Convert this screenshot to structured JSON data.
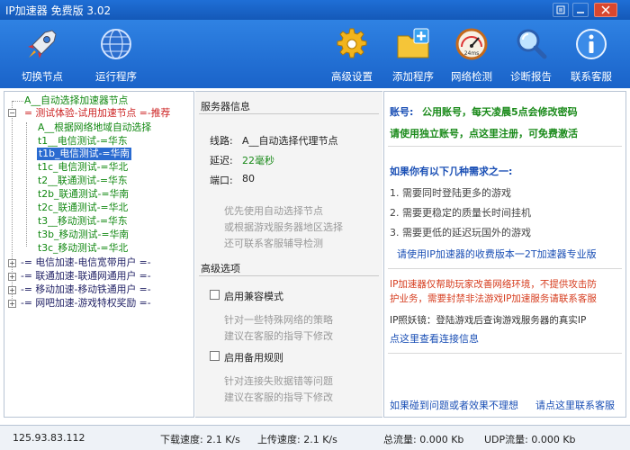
{
  "window": {
    "title": "IP加速器 免费版 3.02"
  },
  "toolbar": {
    "switch_node": "切换节点",
    "run_program": "运行程序",
    "advanced": "高级设置",
    "add_program": "添加程序",
    "net_detect": "网络检测",
    "diag_report": "诊断报告",
    "contact": "联系客服",
    "gauge_text": "24ms"
  },
  "tree": {
    "items": [
      {
        "text": "A__自动选择加速器节点"
      },
      {
        "text": "= 测试体验-试用加速节点 =-推荐"
      },
      {
        "text": "A__根据网络地域自动选择"
      },
      {
        "text": "t1__电信测试-=华东"
      },
      {
        "text": "t1b_电信测试-=华南"
      },
      {
        "text": "t1c_电信测试-=华北"
      },
      {
        "text": "t2__联通测试-=华东"
      },
      {
        "text": "t2b_联通测试-=华南"
      },
      {
        "text": "t2c_联通测试-=华北"
      },
      {
        "text": "t3__移动测试-=华东"
      },
      {
        "text": "t3b_移动测试-=华南"
      },
      {
        "text": "t3c_移动测试-=华北"
      },
      {
        "text": "-= 电信加速-电信宽带用户 =-"
      },
      {
        "text": "-= 联通加速-联通网通用户 =-"
      },
      {
        "text": "-= 移动加速-移动铁通用户 =-"
      },
      {
        "text": "-= 网吧加速-游戏特权奖励 =-"
      }
    ]
  },
  "server": {
    "section": "服务器信息",
    "line_label": "线路:",
    "line_value": "A__自动选择代理节点",
    "latency_label": "延迟:",
    "latency_value": "22毫秒",
    "port_label": "端口:",
    "port_value": "80",
    "hint1": "优先使用自动选择节点",
    "hint2": "或根据游戏服务器地区选择",
    "hint3": "还可联系客服辅导检测",
    "adv_section": "高级选项",
    "compat_label": "启用兼容模式",
    "compat_hint1": "针对一些特殊网络的策略",
    "compat_hint2": "建议在客服的指导下修改",
    "backup_label": "启用备用规则",
    "backup_hint1": "针对连接失败据错等问题",
    "backup_hint2": "建议在客服的指导下修改"
  },
  "info": {
    "account_label": "账号:",
    "account_value": "公用账号，每天凌晨5点会修改密码",
    "register": "请使用独立账号，点这里注册，可免费激活",
    "need_title": "如果你有以下几种需求之一:",
    "need1": "1.  需要同时登陆更多的游戏",
    "need2": "2.  需要更稳定的质量长时间挂机",
    "need3": "3.  需要更低的延迟玩国外的游戏",
    "pro": "请使用IP加速器的收费版本一2T加速器专业版",
    "warn1": "IP加速器仅帮助玩家改善网络环境，不提供攻击防",
    "warn2": "护业务，需要封禁非法游戏IP加速服务请联系客服",
    "tip": "IP照妖镜：登陆游戏后查询游戏服务器的真实IP",
    "tip_link": "点这里查看连接信息",
    "problem": "如果碰到问题或者效果不理想",
    "problem_link": "请点这里联系客服"
  },
  "status": {
    "ip": "125.93.83.112",
    "download": "下载速度: 2.1 K/s",
    "upload": "上传速度: 2.1 K/s",
    "total": "总流量: 0.000 Kb",
    "udp": "UDP流量: 0.000 Kb"
  },
  "colors": {
    "titlebar": "#1f6fd6",
    "toolbar": "#2f82e3",
    "tree_green": "#118811",
    "tree_red": "#cc2222",
    "tree_navy": "#222266",
    "selection": "#2a6bd1",
    "link_blue": "#1a4fb5",
    "warn_red": "#d63c1e",
    "green_text": "#1a8a1a"
  }
}
